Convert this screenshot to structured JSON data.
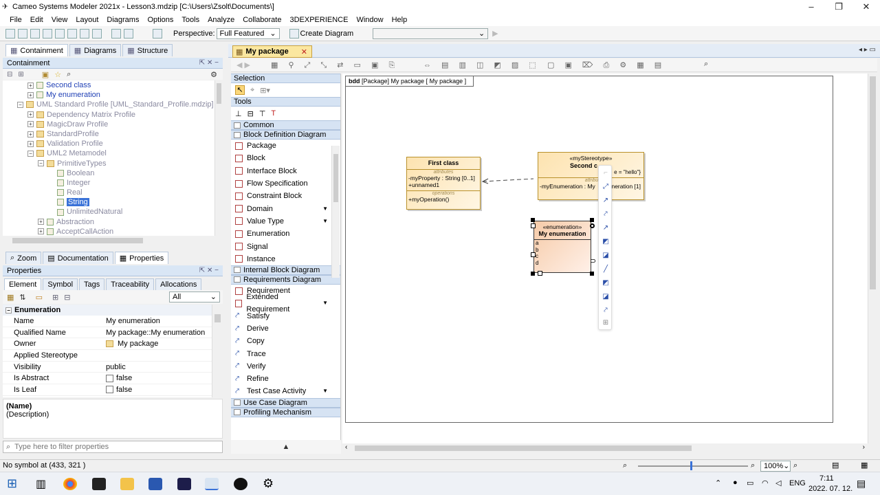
{
  "window": {
    "title": "Cameo Systems Modeler 2021x - Lesson3.mdzip [C:\\Users\\Zsolt\\Documents\\]"
  },
  "menu": [
    "File",
    "Edit",
    "View",
    "Layout",
    "Diagrams",
    "Options",
    "Tools",
    "Analyze",
    "Collaborate",
    "3DEXPERIENCE",
    "Window",
    "Help"
  ],
  "toolbar": {
    "perspective_label": "Perspective:",
    "perspective_value": "Full Featured",
    "create_diagram": "Create Diagram"
  },
  "browser": {
    "tabs": [
      "Containment",
      "Diagrams",
      "Structure"
    ],
    "panel_title": "Containment",
    "tree": [
      {
        "label": "Second class",
        "indent": 2,
        "style": "blue",
        "icon": "class",
        "exp": "+"
      },
      {
        "label": "My enumeration",
        "indent": 2,
        "style": "blue",
        "icon": "class",
        "exp": "+"
      },
      {
        "label": "UML Standard Profile [UML_Standard_Profile.mdzip]",
        "indent": 1,
        "style": "gray",
        "icon": "folder",
        "exp": "-"
      },
      {
        "label": "Dependency Matrix Profile",
        "indent": 2,
        "style": "gray",
        "icon": "folder",
        "exp": "+"
      },
      {
        "label": "MagicDraw Profile",
        "indent": 2,
        "style": "gray",
        "icon": "folder",
        "exp": "+"
      },
      {
        "label": "StandardProfile",
        "indent": 2,
        "style": "gray",
        "icon": "folder",
        "exp": "+"
      },
      {
        "label": "Validation Profile",
        "indent": 2,
        "style": "gray",
        "icon": "folder",
        "exp": "+"
      },
      {
        "label": "UML2 Metamodel",
        "indent": 2,
        "style": "gray",
        "icon": "folder",
        "exp": "-"
      },
      {
        "label": "PrimitiveTypes",
        "indent": 3,
        "style": "gray",
        "icon": "folder",
        "exp": "-"
      },
      {
        "label": "Boolean",
        "indent": 4,
        "style": "gray",
        "icon": "class",
        "exp": ""
      },
      {
        "label": "Integer",
        "indent": 4,
        "style": "gray",
        "icon": "class",
        "exp": ""
      },
      {
        "label": "Real",
        "indent": 4,
        "style": "gray",
        "icon": "class",
        "exp": ""
      },
      {
        "label": "String",
        "indent": 4,
        "style": "selected",
        "icon": "class",
        "exp": ""
      },
      {
        "label": "UnlimitedNatural",
        "indent": 4,
        "style": "gray",
        "icon": "class",
        "exp": ""
      },
      {
        "label": "Abstraction",
        "indent": 3,
        "style": "gray",
        "icon": "class",
        "exp": "+"
      },
      {
        "label": "AcceptCallAction",
        "indent": 3,
        "style": "gray",
        "icon": "class",
        "exp": "+"
      }
    ]
  },
  "lower_tabs": [
    "Zoom",
    "Documentation",
    "Properties"
  ],
  "properties": {
    "panel_title": "Properties",
    "tabs": [
      "Element",
      "Symbol",
      "Tags",
      "Traceability",
      "Allocations"
    ],
    "filter_value": "All",
    "section": "Enumeration",
    "rows": [
      {
        "key": "Name",
        "value": "My enumeration",
        "kind": "text"
      },
      {
        "key": "Qualified Name",
        "value": "My package::My enumeration",
        "kind": "text"
      },
      {
        "key": "Owner",
        "value": "My package",
        "kind": "folder"
      },
      {
        "key": "Applied Stereotype",
        "value": "",
        "kind": "text"
      },
      {
        "key": "Visibility",
        "value": "public",
        "kind": "text"
      },
      {
        "key": "Is Abstract",
        "value": "false",
        "kind": "check"
      },
      {
        "key": "Is Leaf",
        "value": "false",
        "kind": "check"
      }
    ],
    "desc_name": "(Name)",
    "desc_text": "(Description)",
    "filter_placeholder": "Type here to filter properties"
  },
  "diagram_tab": "My package",
  "palette": {
    "selection_title": "Selection",
    "tools_title": "Tools",
    "groups": [
      {
        "title": "Common",
        "items": []
      },
      {
        "title": "Block Definition Diagram",
        "items": [
          {
            "label": "Package",
            "icon": "box"
          },
          {
            "label": "Block",
            "icon": "box"
          },
          {
            "label": "Interface Block",
            "icon": "box"
          },
          {
            "label": "Flow Specification",
            "icon": "box"
          },
          {
            "label": "Constraint Block",
            "icon": "box"
          },
          {
            "label": "Domain",
            "icon": "box",
            "more": true
          },
          {
            "label": "Value Type",
            "icon": "box",
            "more": true
          },
          {
            "label": "Enumeration",
            "icon": "box"
          },
          {
            "label": "Signal",
            "icon": "box"
          },
          {
            "label": "Instance",
            "icon": "box"
          }
        ]
      },
      {
        "title": "Internal Block Diagram",
        "items": []
      },
      {
        "title": "Requirements Diagram",
        "items": [
          {
            "label": "Requirement",
            "icon": "box"
          },
          {
            "label": "Extended Requirement",
            "icon": "box",
            "more": true
          },
          {
            "label": "Satisfy",
            "icon": "arrow"
          },
          {
            "label": "Derive",
            "icon": "arrow"
          },
          {
            "label": "Copy",
            "icon": "arrow"
          },
          {
            "label": "Trace",
            "icon": "arrow"
          },
          {
            "label": "Verify",
            "icon": "arrow"
          },
          {
            "label": "Refine",
            "icon": "arrow"
          },
          {
            "label": "Test Case Activity",
            "icon": "arrow",
            "more": true
          }
        ]
      },
      {
        "title": "Use Case Diagram",
        "items": []
      },
      {
        "title": "Profiling Mechanism",
        "items": []
      }
    ]
  },
  "diagram": {
    "frame_kind": "bdd",
    "frame_label": "[Package] My package [ My package ]",
    "first_class": {
      "name": "First class",
      "attr_caption": "attributes",
      "attrs": [
        "-myProperty : String [0..1]",
        "+unnamed1"
      ],
      "ops_caption": "operations",
      "ops": [
        "+myOperation()"
      ]
    },
    "second_class": {
      "stereotype": "«myStereotype»",
      "name": "Second c",
      "tag": "e = \"hello\"}",
      "attr_caption": "attribute",
      "attrs": [
        "-myEnumeration : My",
        "neration [1]"
      ]
    },
    "enumeration": {
      "stereotype": "«enumeration»",
      "name": "My enumeration",
      "literals": [
        "a",
        "b",
        "c",
        "d"
      ]
    }
  },
  "status": {
    "message": "No symbol at (433, 321 )",
    "zoom": "100%"
  },
  "taskbar": {
    "lang": "ENG",
    "time": "7:11",
    "date": "2022. 07. 12."
  },
  "colors": {
    "panel_blue": "#d9e6f5",
    "selection": "#3a72d8",
    "node_fill": "#fde3b0",
    "enum_fill": "#f6cba8"
  }
}
